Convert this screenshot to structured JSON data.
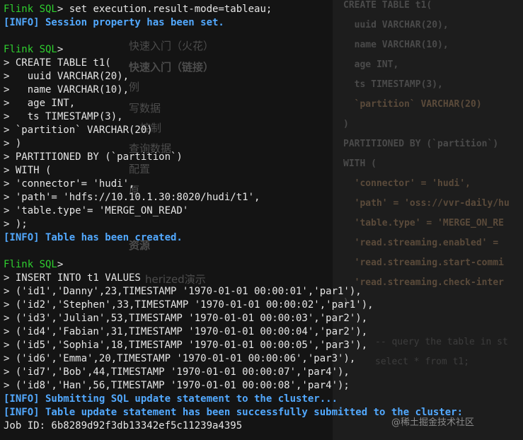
{
  "terminal": {
    "prompt": "Flink SQL",
    "prompt_suffix": ">",
    "cmd1": " set execution.result-mode=tableau;",
    "info1": "[INFO] Session property has been set.",
    "create_lines": [
      "> CREATE TABLE t1(",
      ">   uuid VARCHAR(20),",
      ">   name VARCHAR(10),",
      ">   age INT,",
      ">   ts TIMESTAMP(3),",
      "> `partition` VARCHAR(20)",
      "> )",
      "> PARTITIONED BY (`partition`)",
      "> WITH (",
      "> 'connector'= 'hudi',",
      "> 'path'= 'hdfs://10.10.1.30:8020/hudi/t1',",
      "> 'table.type'= 'MERGE_ON_READ'",
      "> );"
    ],
    "info2": "[INFO] Table has been created.",
    "insert_lines": [
      "> INSERT INTO t1 VALUES",
      "> ('id1','Danny',23,TIMESTAMP '1970-01-01 00:00:01','par1'),",
      "> ('id2','Stephen',33,TIMESTAMP '1970-01-01 00:00:02','par1'),",
      "> ('id3','Julian',53,TIMESTAMP '1970-01-01 00:00:03','par2'),",
      "> ('id4','Fabian',31,TIMESTAMP '1970-01-01 00:00:04','par2'),",
      "> ('id5','Sophia',18,TIMESTAMP '1970-01-01 00:00:05','par3'),",
      "> ('id6','Emma',20,TIMESTAMP '1970-01-01 00:00:06','par3'),",
      "> ('id7','Bob',44,TIMESTAMP '1970-01-01 00:00:07','par4'),",
      "> ('id8','Han',56,TIMESTAMP '1970-01-01 00:00:08','par4');"
    ],
    "info3": "[INFO] Submitting SQL update statement to the cluster...",
    "info4": "[INFO] Table update statement has been successfully submitted to the cluster:",
    "job_id": "Job ID: 6b8289d92f3db13342ef5c11239a4395"
  },
  "background_menu": [
    "快速入门（火花）",
    "快速入门（链接）",
    "例",
    "写数据",
    "控制",
    "查询数据",
    "配置",
    "原",
    "资源",
    "herized演示"
  ],
  "background_code": [
    "CREATE TABLE t1(",
    "  uuid VARCHAR(20),",
    "  name VARCHAR(10),",
    "  age INT,",
    "  ts TIMESTAMP(3),",
    "  `partition` VARCHAR(20)",
    ")",
    "PARTITIONED BY (`partition`)",
    "WITH (",
    "  'connector' = 'hudi',",
    "  'path' = 'oss://vvr-daily/hu",
    "  'table.type' = 'MERGE_ON_RE",
    "  'read.streaming.enabled' = ",
    "  'read.streaming.start-commi",
    "  'read.streaming.check-inter",
    ");",
    "-- query the table in st",
    "select * from t1;"
  ],
  "watermark": "@稀土掘金技术社区",
  "colors": {
    "prompt": "#2fcf2f",
    "info": "#52a9ff",
    "text": "#e6e6e6",
    "background": "#141414"
  }
}
